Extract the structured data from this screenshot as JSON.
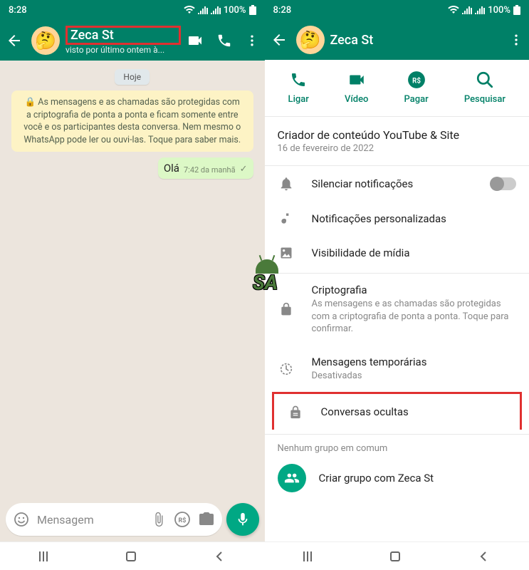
{
  "status": {
    "time": "8:28",
    "battery": "100%"
  },
  "left": {
    "contact_name": "Zeca St",
    "last_seen": "visto por último ontem à...",
    "date_label": "Hoje",
    "encryption_notice": "🔒 As mensagens e as chamadas são protegidas com a criptografia de ponta a ponta e ficam somente entre você e os participantes desta conversa. Nem mesmo o WhatsApp pode ler ou ouvi-las. Toque para saber mais.",
    "message": {
      "text": "Olá",
      "time": "7:42 da manhã"
    },
    "input_placeholder": "Mensagem"
  },
  "right": {
    "contact_name": "Zeca St",
    "actions": {
      "call": "Ligar",
      "video": "Vídeo",
      "pay": "Pagar",
      "search": "Pesquisar"
    },
    "about": {
      "title": "Criador de conteúdo YouTube & Site",
      "date": "16 de fevereiro de 2022"
    },
    "settings": {
      "mute": "Silenciar notificações",
      "custom_notif": "Notificações personalizadas",
      "media_vis": "Visibilidade de mídia",
      "crypto_label": "Criptografia",
      "crypto_desc": "As mensagens e as chamadas são protegidas com a criptografia de ponta a ponta. Toque para confirmar.",
      "disappearing_label": "Mensagens temporárias",
      "disappearing_desc": "Desativadas",
      "hidden": "Conversas ocultas"
    },
    "no_groups": "Nenhum grupo em comum",
    "create_group": "Criar grupo com Zeca St"
  }
}
